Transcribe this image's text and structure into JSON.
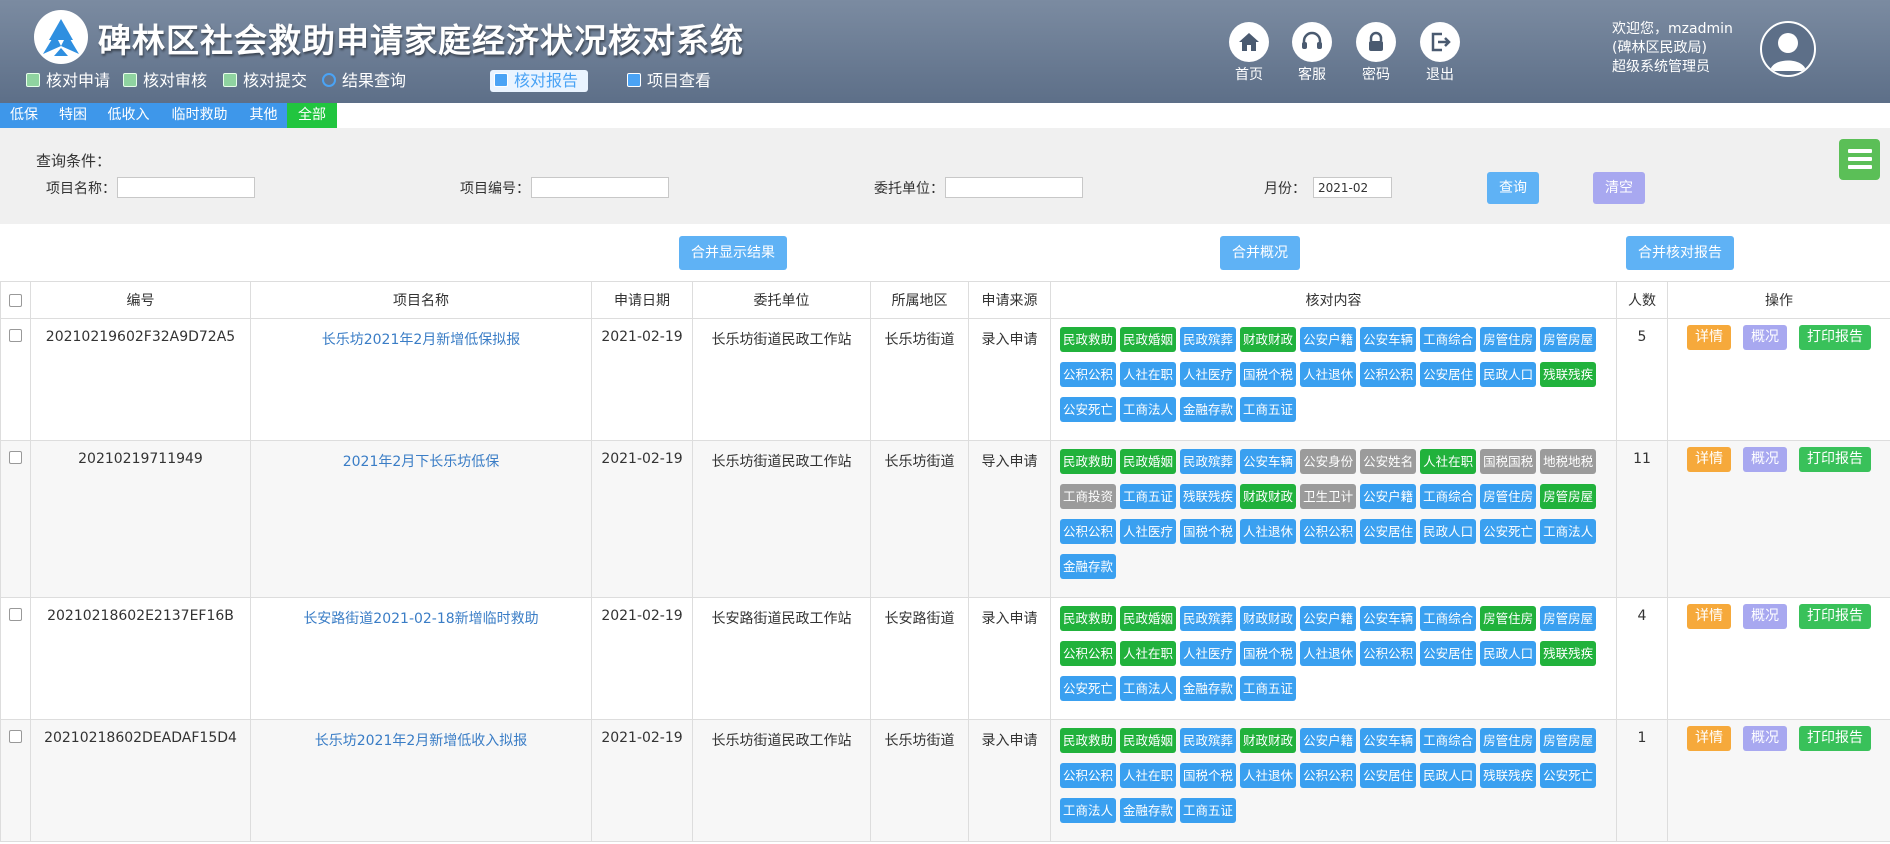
{
  "app": {
    "title": "碑林区社会救助申请家庭经济状况核对系统"
  },
  "main_nav": [
    {
      "label": "核对申请",
      "icon": "document-icon"
    },
    {
      "label": "核对审核",
      "icon": "document-icon"
    },
    {
      "label": "核对提交",
      "icon": "document-icon"
    },
    {
      "label": "结果查询",
      "icon": "search-icon"
    },
    {
      "label": "核对报告",
      "icon": "monitor-icon",
      "active": true
    },
    {
      "label": "项目查看",
      "icon": "monitor-icon"
    }
  ],
  "toolbar": [
    {
      "label": "首页",
      "icon": "home-icon"
    },
    {
      "label": "客服",
      "icon": "headset-icon"
    },
    {
      "label": "密码",
      "icon": "lock-icon"
    },
    {
      "label": "退出",
      "icon": "logout-icon"
    }
  ],
  "user": {
    "welcome": "欢迎您，mzadmin",
    "org": "(碑林区民政局)",
    "role": "超级系统管理员"
  },
  "type_tabs": [
    {
      "label": "低保"
    },
    {
      "label": "特困"
    },
    {
      "label": "低收入"
    },
    {
      "label": "临时救助"
    },
    {
      "label": "其他"
    },
    {
      "label": "全部",
      "active": true
    }
  ],
  "filter": {
    "title": "查询条件：",
    "project_name_label": "项目名称：",
    "project_name_value": "",
    "project_no_label": "项目编号：",
    "project_no_value": "",
    "unit_label": "委托单位：",
    "unit_value": "",
    "month_label": "月份：",
    "month_value": "2021-02",
    "query_label": "查询",
    "clear_label": "清空"
  },
  "actions": {
    "merge_results": "合并显示结果",
    "merge_overview": "合并概况",
    "merge_report": "合并核对报告"
  },
  "table": {
    "headers": [
      "编号",
      "项目名称",
      "申请日期",
      "委托单位",
      "所属地区",
      "申请来源",
      "核对内容",
      "人数",
      "操作"
    ],
    "op_labels": {
      "detail": "详情",
      "overview": "概况",
      "print": "打印报告"
    },
    "rows": [
      {
        "id": "20210219602F32A9D72A5",
        "name": "长乐坊2021年2月新增低保拟报",
        "date": "2021-02-19",
        "unit": "长乐坊街道民政工作站",
        "region": "长乐坊街道",
        "source": "录入申请",
        "count": "5",
        "tags": [
          {
            "t": "民政救助",
            "c": "green"
          },
          {
            "t": "民政婚姻",
            "c": "green"
          },
          {
            "t": "民政殡葬",
            "c": "blue"
          },
          {
            "t": "财政财政",
            "c": "green"
          },
          {
            "t": "公安户籍",
            "c": "blue"
          },
          {
            "t": "公安车辆",
            "c": "blue"
          },
          {
            "t": "工商综合",
            "c": "blue"
          },
          {
            "t": "房管住房",
            "c": "blue"
          },
          {
            "t": "房管房屋",
            "c": "blue"
          },
          {
            "t": "公积公积",
            "c": "blue"
          },
          {
            "t": "人社在职",
            "c": "blue"
          },
          {
            "t": "人社医疗",
            "c": "blue"
          },
          {
            "t": "国税个税",
            "c": "blue"
          },
          {
            "t": "人社退休",
            "c": "blue"
          },
          {
            "t": "公积公积",
            "c": "blue"
          },
          {
            "t": "公安居住",
            "c": "blue"
          },
          {
            "t": "民政人口",
            "c": "blue"
          },
          {
            "t": "残联残疾",
            "c": "green"
          },
          {
            "t": "公安死亡",
            "c": "blue"
          },
          {
            "t": "工商法人",
            "c": "blue"
          },
          {
            "t": "金融存款",
            "c": "blue"
          },
          {
            "t": "工商五证",
            "c": "blue"
          }
        ]
      },
      {
        "id": "20210219711949",
        "name": "2021年2月下长乐坊低保",
        "date": "2021-02-19",
        "unit": "长乐坊街道民政工作站",
        "region": "长乐坊街道",
        "source": "导入申请",
        "count": "11",
        "tags": [
          {
            "t": "民政救助",
            "c": "green"
          },
          {
            "t": "民政婚姻",
            "c": "green"
          },
          {
            "t": "民政殡葬",
            "c": "blue"
          },
          {
            "t": "公安车辆",
            "c": "blue"
          },
          {
            "t": "公安身份",
            "c": "gray"
          },
          {
            "t": "公安姓名",
            "c": "gray"
          },
          {
            "t": "人社在职",
            "c": "green"
          },
          {
            "t": "国税国税",
            "c": "gray"
          },
          {
            "t": "地税地税",
            "c": "gray"
          },
          {
            "t": "工商投资",
            "c": "gray"
          },
          {
            "t": "工商五证",
            "c": "blue"
          },
          {
            "t": "残联残疾",
            "c": "blue"
          },
          {
            "t": "财政财政",
            "c": "green"
          },
          {
            "t": "卫生卫计",
            "c": "gray"
          },
          {
            "t": "公安户籍",
            "c": "blue"
          },
          {
            "t": "工商综合",
            "c": "blue"
          },
          {
            "t": "房管住房",
            "c": "blue"
          },
          {
            "t": "房管房屋",
            "c": "green"
          },
          {
            "t": "公积公积",
            "c": "blue"
          },
          {
            "t": "人社医疗",
            "c": "blue"
          },
          {
            "t": "国税个税",
            "c": "blue"
          },
          {
            "t": "人社退休",
            "c": "blue"
          },
          {
            "t": "公积公积",
            "c": "blue"
          },
          {
            "t": "公安居住",
            "c": "blue"
          },
          {
            "t": "民政人口",
            "c": "blue"
          },
          {
            "t": "公安死亡",
            "c": "blue"
          },
          {
            "t": "工商法人",
            "c": "blue"
          },
          {
            "t": "金融存款",
            "c": "blue"
          }
        ]
      },
      {
        "id": "20210218602E2137EF16B",
        "name": "长安路街道2021-02-18新增临时救助",
        "date": "2021-02-19",
        "unit": "长安路街道民政工作站",
        "region": "长安路街道",
        "source": "录入申请",
        "count": "4",
        "tags": [
          {
            "t": "民政救助",
            "c": "green"
          },
          {
            "t": "民政婚姻",
            "c": "green"
          },
          {
            "t": "民政殡葬",
            "c": "blue"
          },
          {
            "t": "财政财政",
            "c": "blue"
          },
          {
            "t": "公安户籍",
            "c": "blue"
          },
          {
            "t": "公安车辆",
            "c": "blue"
          },
          {
            "t": "工商综合",
            "c": "blue"
          },
          {
            "t": "房管住房",
            "c": "green"
          },
          {
            "t": "房管房屋",
            "c": "blue"
          },
          {
            "t": "公积公积",
            "c": "green"
          },
          {
            "t": "人社在职",
            "c": "green"
          },
          {
            "t": "人社医疗",
            "c": "blue"
          },
          {
            "t": "国税个税",
            "c": "blue"
          },
          {
            "t": "人社退休",
            "c": "blue"
          },
          {
            "t": "公积公积",
            "c": "blue"
          },
          {
            "t": "公安居住",
            "c": "blue"
          },
          {
            "t": "民政人口",
            "c": "blue"
          },
          {
            "t": "残联残疾",
            "c": "green"
          },
          {
            "t": "公安死亡",
            "c": "blue"
          },
          {
            "t": "工商法人",
            "c": "blue"
          },
          {
            "t": "金融存款",
            "c": "blue"
          },
          {
            "t": "工商五证",
            "c": "blue"
          }
        ]
      },
      {
        "id": "20210218602DEADAF15D4",
        "name": "长乐坊2021年2月新增低收入拟报",
        "date": "2021-02-19",
        "unit": "长乐坊街道民政工作站",
        "region": "长乐坊街道",
        "source": "录入申请",
        "count": "1",
        "tags": [
          {
            "t": "民政救助",
            "c": "green"
          },
          {
            "t": "民政婚姻",
            "c": "green"
          },
          {
            "t": "民政殡葬",
            "c": "blue"
          },
          {
            "t": "财政财政",
            "c": "green"
          },
          {
            "t": "公安户籍",
            "c": "blue"
          },
          {
            "t": "公安车辆",
            "c": "blue"
          },
          {
            "t": "工商综合",
            "c": "blue"
          },
          {
            "t": "房管住房",
            "c": "blue"
          },
          {
            "t": "房管房屋",
            "c": "blue"
          },
          {
            "t": "公积公积",
            "c": "blue"
          },
          {
            "t": "人社在职",
            "c": "blue"
          },
          {
            "t": "国税个税",
            "c": "blue"
          },
          {
            "t": "人社退休",
            "c": "blue"
          },
          {
            "t": "公积公积",
            "c": "blue"
          },
          {
            "t": "公安居住",
            "c": "blue"
          },
          {
            "t": "民政人口",
            "c": "blue"
          },
          {
            "t": "残联残疾",
            "c": "blue"
          },
          {
            "t": "公安死亡",
            "c": "blue"
          },
          {
            "t": "工商法人",
            "c": "blue"
          },
          {
            "t": "金融存款",
            "c": "blue"
          },
          {
            "t": "工商五证",
            "c": "blue"
          }
        ]
      }
    ]
  }
}
